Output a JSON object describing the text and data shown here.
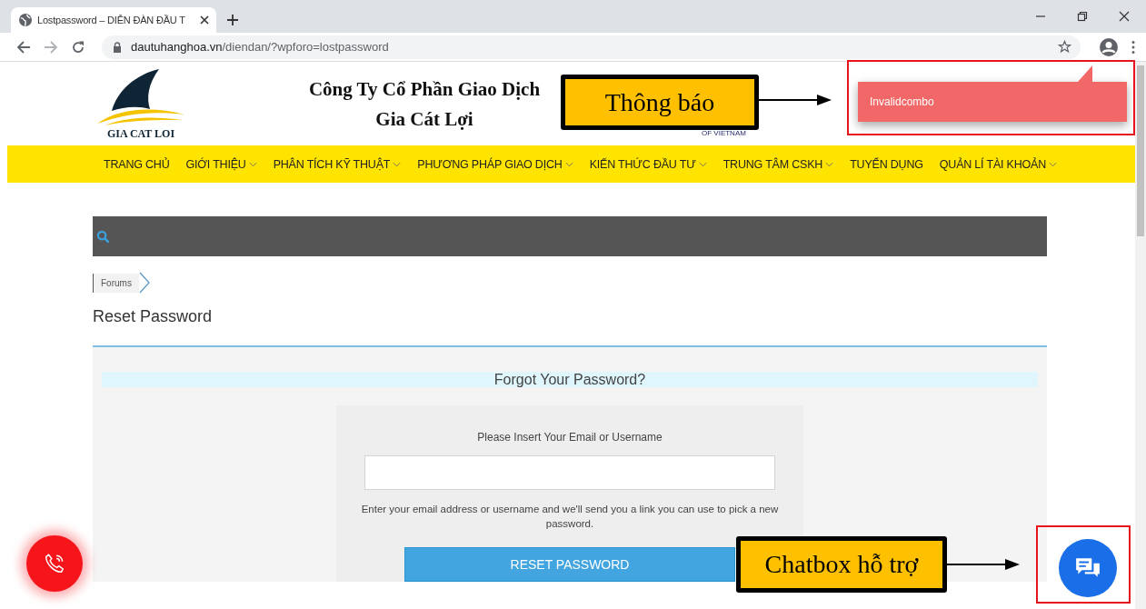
{
  "browser": {
    "tab": {
      "title": "Lostpassword – DIỄN ĐÀN ĐẦU T"
    },
    "url": {
      "domain": "dautuhanghoa.vn",
      "path": "/diendan/?wpforo=lostpassword"
    }
  },
  "header": {
    "logo_text": "GIA CAT LOI",
    "title_lines": [
      "Công Ty Cổ Phần Giao Dịch",
      "Gia Cát Lợi"
    ],
    "badge_text": "OF VIETNAM"
  },
  "nav": [
    {
      "label": "TRANG CHỦ",
      "dropdown": false
    },
    {
      "label": "GIỚI THIỆU",
      "dropdown": true
    },
    {
      "label": "PHÂN TÍCH KỸ THUẬT",
      "dropdown": true
    },
    {
      "label": "PHƯƠNG PHÁP GIAO DỊCH",
      "dropdown": true
    },
    {
      "label": "KIẾN THỨC ĐẦU TƯ",
      "dropdown": true
    },
    {
      "label": "TRUNG TÂM CSKH",
      "dropdown": true
    },
    {
      "label": "TUYỂN DỤNG",
      "dropdown": false
    },
    {
      "label": "QUẢN LÍ TÀI KHOẢN",
      "dropdown": true
    }
  ],
  "breadcrumb": [
    "Forums"
  ],
  "page_title": "Reset Password",
  "form": {
    "heading": "Forgot Your Password?",
    "label": "Please Insert Your Email or Username",
    "hint": "Enter your email address or username and we'll send you a link you can use to pick a new password.",
    "button": "RESET PASSWORD"
  },
  "notification": {
    "text": "Invalidcombo"
  },
  "annotations": [
    {
      "kind": "notification",
      "label": "Thông báo"
    },
    {
      "kind": "chat",
      "label": "Chatbox hỗ trợ"
    }
  ]
}
